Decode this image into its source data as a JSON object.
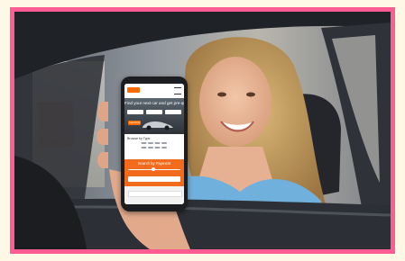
{
  "image": {
    "subject": "Woman sitting in a car holding up a smartphone showing a car-buying website",
    "border_color": "#ff5c93",
    "background_color": "#fff8e6"
  },
  "phone_screen": {
    "headline": "Find your next car and get pre-qual",
    "search_label": "SEARCH",
    "section_label": "Browse by Type",
    "payment_heading": "Search by Payment"
  }
}
